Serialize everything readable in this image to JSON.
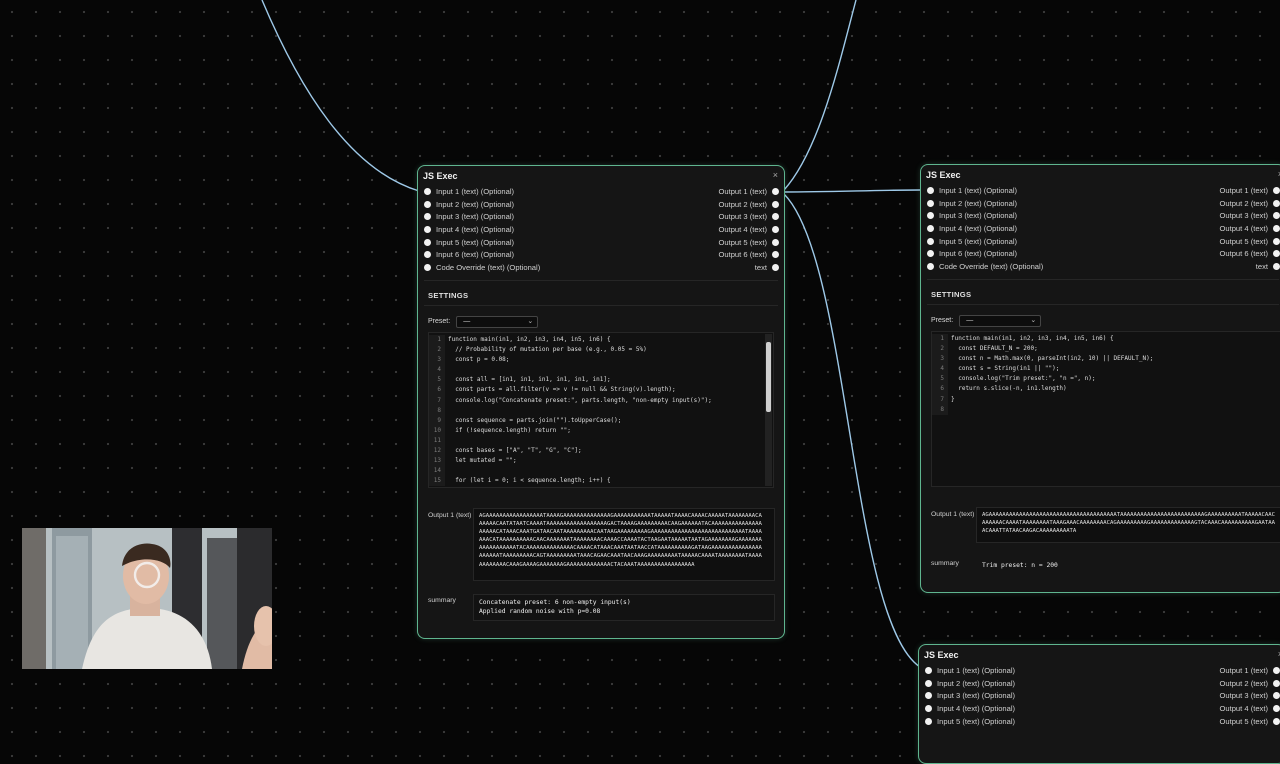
{
  "colors": {
    "accent": "#5fb58f",
    "wire": "#9ec9e8",
    "background": "#060606"
  },
  "nodes": [
    {
      "title": "JS Exec",
      "close": "×",
      "inputs": [
        "Input 1 (text) (Optional)",
        "Input 2 (text) (Optional)",
        "Input 3 (text) (Optional)",
        "Input 4 (text) (Optional)",
        "Input 5 (text) (Optional)",
        "Input 6 (text) (Optional)",
        "Code Override (text) (Optional)"
      ],
      "outputs": [
        "Output 1 (text)",
        "Output 2 (text)",
        "Output 3 (text)",
        "Output 4 (text)",
        "Output 5 (text)",
        "Output 6 (text)",
        "text"
      ],
      "settings_label": "SETTINGS",
      "preset_label": "Preset:",
      "preset_value": "—",
      "code": [
        {
          "n": "1",
          "t": "function main(in1, in2, in3, in4, in5, in6) {"
        },
        {
          "n": "2",
          "t": "  // Probability of mutation per base (e.g., 0.05 = 5%)"
        },
        {
          "n": "3",
          "t": "  const p = 0.08;"
        },
        {
          "n": "4",
          "t": ""
        },
        {
          "n": "5",
          "t": "  const all = [in1, in1, in1, in1, in1, in1];"
        },
        {
          "n": "6",
          "t": "  const parts = all.filter(v => v != null && String(v).length);"
        },
        {
          "n": "7",
          "t": "  console.log(\"Concatenate preset:\", parts.length, \"non-empty input(s)\");"
        },
        {
          "n": "8",
          "t": ""
        },
        {
          "n": "9",
          "t": "  const sequence = parts.join(\"\").toUpperCase();"
        },
        {
          "n": "10",
          "t": "  if (!sequence.length) return \"\";"
        },
        {
          "n": "11",
          "t": ""
        },
        {
          "n": "12",
          "t": "  const bases = [\"A\", \"T\", \"G\", \"C\"];"
        },
        {
          "n": "13",
          "t": "  let mutated = \"\";"
        },
        {
          "n": "14",
          "t": ""
        },
        {
          "n": "15",
          "t": "  for (let i = 0; i < sequence.length; i++) {"
        }
      ],
      "output_label": "Output 1 (text)",
      "output_text": "AGAAAAAAAAAAAAAAAAATAAAAGAAAAAAAAAAAAAAGAAAAAAAAAAATAAAAATAAAACAAAACAAAAATAAAAAAAACAAAAAACAATATAATCAAAATAAAAAAAAAAAAAAAAAAGACTAAAAGAAAAAAAAACAAGAAAAAATACAAAAAAAAAAAAAAAAAAAACATAAACAAATGATAACAATAAAAAAAAACAATAAGAAAAAAAAAGAAAAAAAAAAAAAAAAAAAAAAAAAAAATAAAAAAACATAAAAAAAAAACAACAAAAAAATAAAAAAAACAAAACCAAAATACTAAGAATAAAAATAATAGAAAAAAAAGAAAAAAAAAAAAAAAAAATACAAAAAAAAAAAAAACAAAACATAAACAAATAATAACCATAAAAAAAAAAGATAAGAAAAAAAAAAAAAAAAAAAAATAAAAAAAAACAGTAAAAAAAAATAAACAGAACAAATAACAAAGAAAAAAAAATAAAAACAAAATAAAAAAAATAAAAAAAAAAAACAAAGAAAAGAAAAAAAGAAAAAAAAAAAAACTACAAATAAAAAAAAAAAAAAAAA",
      "summary_label": "summary",
      "summary_text": "Concatenate preset: 6 non-empty input(s)\nApplied random noise with p=0.08"
    },
    {
      "title": "JS Exec",
      "close": "×",
      "inputs": [
        "Input 1 (text) (Optional)",
        "Input 2 (text) (Optional)",
        "Input 3 (text) (Optional)",
        "Input 4 (text) (Optional)",
        "Input 5 (text) (Optional)",
        "Input 6 (text) (Optional)",
        "Code Override (text) (Optional)"
      ],
      "outputs": [
        "Output 1 (text)",
        "Output 2 (text)",
        "Output 3 (text)",
        "Output 4 (text)",
        "Output 5 (text)",
        "Output 6 (text)",
        "text"
      ],
      "settings_label": "SETTINGS",
      "preset_label": "Preset:",
      "preset_value": "—",
      "code": [
        {
          "n": "1",
          "t": "function main(in1, in2, in3, in4, in5, in6) {"
        },
        {
          "n": "2",
          "t": "  const DEFAULT_N = 200;"
        },
        {
          "n": "3",
          "t": "  const n = Math.max(0, parseInt(in2, 10) || DEFAULT_N);"
        },
        {
          "n": "4",
          "t": "  const s = String(in1 || \"\");"
        },
        {
          "n": "5",
          "t": "  console.log(\"Trim preset:\", \"n =\", n);"
        },
        {
          "n": "6",
          "t": "  return s.slice(-n, in1.length)"
        },
        {
          "n": "7",
          "t": "}"
        },
        {
          "n": "8",
          "t": ""
        }
      ],
      "output_label": "Output 1 (text)",
      "output_text": "AGAAAAAAAAAAAAAAAAAAAAAAAAAAAAAAAAAAAAAATAAAAAAAAAAAAAAAAAAAAAAAAAGAAAAAAAAAATAAAAACAACAAAAAACAAAATAAAAAAAATAAAGAAACAAAAAAAACAGAAAAAAAAAGAAAAAAAAAAAAAGTACAAACAAAAAAAAAAGAATAAACAAATTATAACAAGACAAAAAAAAATA",
      "summary_label": "summary",
      "summary_text": "Trim preset: n = 200"
    },
    {
      "title": "JS Exec",
      "close": "×",
      "inputs": [
        "Input 1 (text) (Optional)",
        "Input 2 (text) (Optional)",
        "Input 3 (text) (Optional)",
        "Input 4 (text) (Optional)",
        "Input 5 (text) (Optional)"
      ],
      "outputs": [
        "Output 1 (text)",
        "Output 2 (text)",
        "Output 3 (text)",
        "Output 4 (text)",
        "Output 5 (text)"
      ]
    }
  ]
}
